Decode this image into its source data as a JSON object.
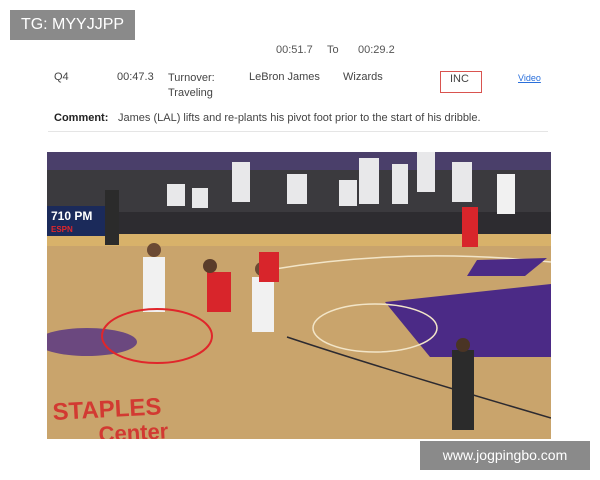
{
  "watermark_top": "TG: MYYJJPP",
  "watermark_bottom": "www.jogpingbo.com",
  "time_range": {
    "start": "00:51.7",
    "to": "To",
    "end": "00:29.2"
  },
  "entry": {
    "period": "Q4",
    "time": "00:47.3",
    "call_line1": "Turnover:",
    "call_line2": "Traveling",
    "player": "LeBron James",
    "team": "Wizards",
    "decision": "INC",
    "video_link": "Video"
  },
  "comment": {
    "label": "Comment:",
    "text": "James (LAL) lifts and re-plants his pivot foot prior to the start of his dribble."
  },
  "video_frame": {
    "scoreboard_text": "710 PM",
    "network": "ESPN",
    "arena_text_line1": "STAPLES",
    "arena_text_line2": "Center",
    "highlight_color": "#e0262b",
    "court_color": "#c9a46c",
    "lakers_purple": "#4b2a86"
  }
}
